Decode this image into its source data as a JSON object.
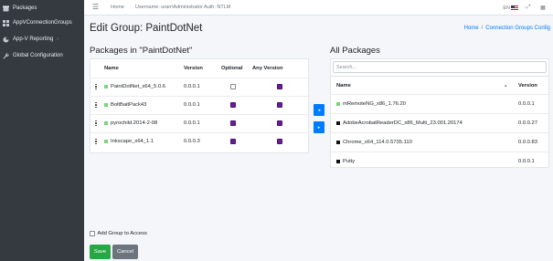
{
  "sidebar": {
    "items": [
      {
        "label": "Packages",
        "icon": "package-icon"
      },
      {
        "label": "AppVConnectionGroups",
        "icon": "grid-icon"
      },
      {
        "label": "App-V Reporting",
        "icon": "chart-icon",
        "caret": "‹"
      },
      {
        "label": "Global Configuration",
        "icon": "wrench-icon"
      }
    ]
  },
  "navbar": {
    "menu_icon": "☰",
    "home": "Home",
    "user_info": "Username: urarr\\Administrator Auth: NTLM",
    "lang": "EN",
    "expand_icon": "⤢",
    "grid_icon": "▦"
  },
  "page": {
    "title": "Edit Group: PaintDotNet",
    "breadcrumb": {
      "home": "Home",
      "separator": "/",
      "current": "Connection Groups Config"
    }
  },
  "group_packages": {
    "title": "Packages in \"PaintDotNet\"",
    "columns": {
      "name": "Name",
      "version": "Version",
      "optional": "Optional",
      "any_version": "Any Version"
    },
    "rows": [
      {
        "name": "PaintDotNet_x64_5.0.6",
        "version": "0.0.0.1",
        "optional": false,
        "any_version": true
      },
      {
        "name": "BoltBaitPack43",
        "version": "0.0.0.1",
        "optional": true,
        "any_version": true
      },
      {
        "name": "pyrochild.2014-2-08",
        "version": "0.0.0.1",
        "optional": true,
        "any_version": true
      },
      {
        "name": "Inkscape_x64_1.1",
        "version": "0.0.0.3",
        "optional": true,
        "any_version": true
      }
    ]
  },
  "move_buttons": {
    "add": "◂",
    "remove": "▸"
  },
  "all_packages": {
    "title": "All Packages",
    "search_placeholder": "Search...",
    "columns": {
      "name": "Name",
      "version": "Version"
    },
    "sort_icon": "▲",
    "rows": [
      {
        "name": "mRemoteNG_x86_1.76.20",
        "version": "0.0.0.1",
        "color": "#7bd47b"
      },
      {
        "name": "AdobeAcrobatReaderDC_x86_Multi_23.001.20174",
        "version": "0.0.0.27",
        "color": "#111111"
      },
      {
        "name": "Chrome_x64_114.0.5735.110",
        "version": "0.0.0.83",
        "color": "#111111"
      },
      {
        "name": "Putty",
        "version": "0.0.0.1",
        "color": "#111111"
      }
    ]
  },
  "footer": {
    "add_group_label": "Add Group to Access",
    "save": "Save",
    "cancel": "Cancel"
  },
  "colors": {
    "sidebar_bg": "#343a40",
    "accent": "#007bff",
    "save": "#28a745",
    "cancel": "#6c757d",
    "checked": "#6a1b9a"
  }
}
